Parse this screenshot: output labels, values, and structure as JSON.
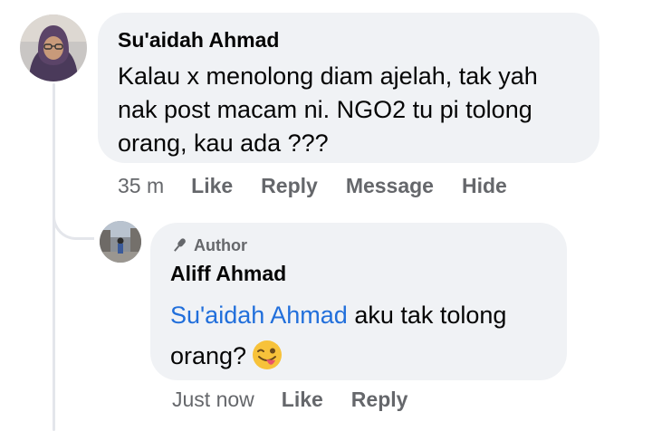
{
  "comment": {
    "author": "Su'aidah Ahmad",
    "text": "Kalau x menolong diam ajelah, tak yah nak post macam ni. NGO2 tu pi tolong orang, kau ada ???",
    "time": "35 m",
    "actions": [
      "Like",
      "Reply",
      "Message",
      "Hide"
    ]
  },
  "reply": {
    "badge": "Author",
    "badge_icon": "microphone-icon",
    "author": "Aliff Ahmad",
    "mention": "Su'aidah Ahmad",
    "text": " aku tak tolong orang?",
    "emoji": "winking-face-with-tongue",
    "time": "Just now",
    "actions": [
      "Like",
      "Reply"
    ]
  },
  "colors": {
    "bubble": "#f0f2f5",
    "mention": "#216fdb",
    "meta": "#65676b",
    "thread_line": "#e4e6eb"
  }
}
